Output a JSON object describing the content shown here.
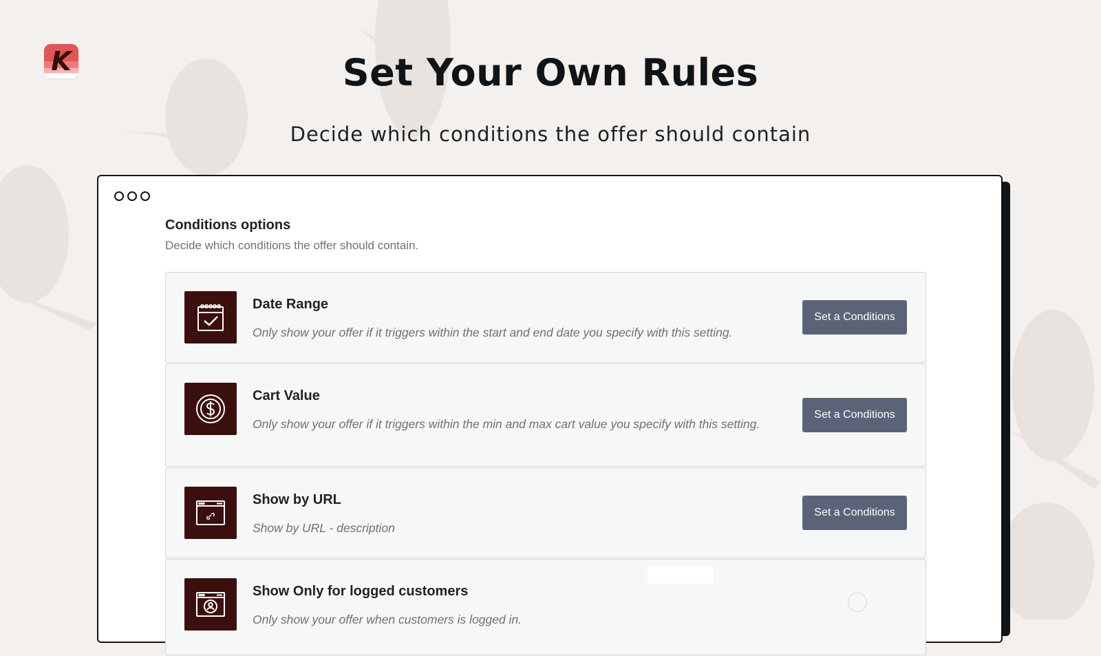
{
  "hero": {
    "title": "Set Your Own Rules",
    "subtitle": "Decide which conditions the offer should contain"
  },
  "logo": {
    "letter": "K"
  },
  "panel": {
    "title": "Conditions options",
    "description": "Decide which conditions the offer should contain."
  },
  "conditions": [
    {
      "title": "Date Range",
      "description": "Only show your offer if it triggers within the start and end date you specify with this setting.",
      "button_label": "Set a Conditions",
      "icon": "calendar-check-icon"
    },
    {
      "title": "Cart Value",
      "description": "Only show your offer if it triggers within the min and max cart value you specify with this setting.",
      "button_label": "Set a Conditions",
      "icon": "dollar-circle-icon"
    },
    {
      "title": "Show by URL",
      "description": "Show by URL - description",
      "button_label": "Set a Conditions",
      "icon": "browser-link-icon"
    },
    {
      "title": "Show Only for logged customers",
      "description": "Only show your offer when customers is logged in.",
      "icon": "browser-user-icon"
    }
  ],
  "colors": {
    "background": "#f3f0ed",
    "icon_bg": "#3c0f0f",
    "button_bg": "#5c6378",
    "logo_red": "#e05555"
  }
}
